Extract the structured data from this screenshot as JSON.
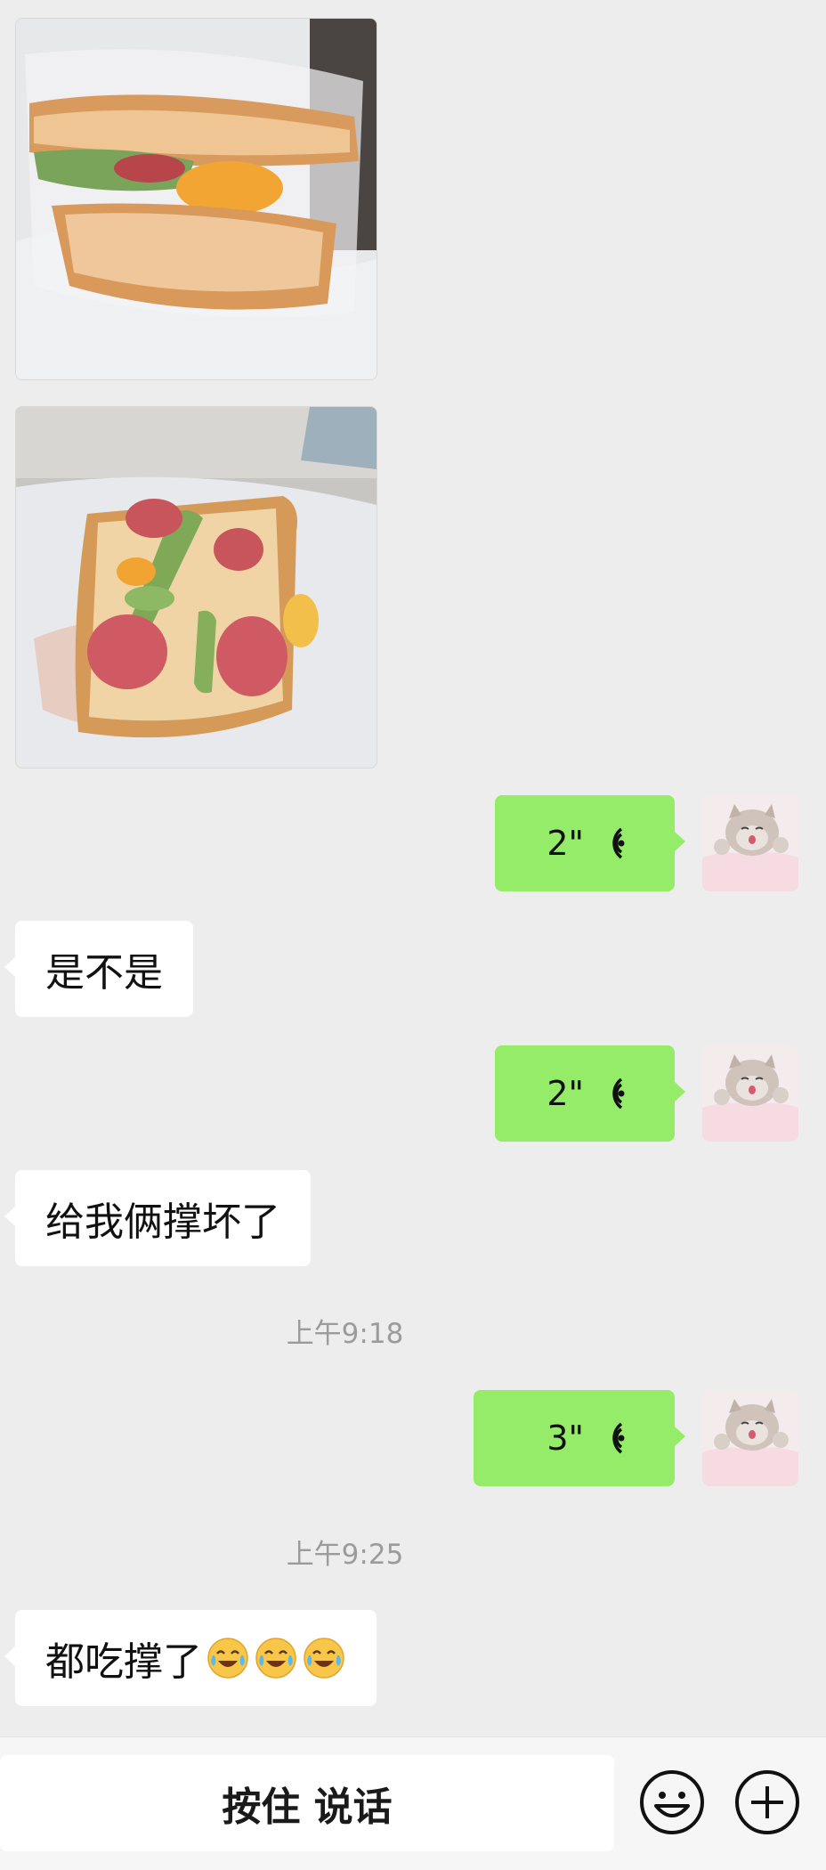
{
  "colors": {
    "background": "#ededed",
    "outgoing_bubble": "#95ec69",
    "incoming_bubble": "#ffffff",
    "timestamp_text": "#9b9b9b"
  },
  "messages": {
    "photo1": {
      "icon": "sandwich-photo"
    },
    "photo2": {
      "icon": "open-sandwich-photo"
    },
    "voice1": {
      "duration": "2\"",
      "icon": "voice-wave-icon"
    },
    "text1": {
      "text": "是不是"
    },
    "voice2": {
      "duration": "2\"",
      "icon": "voice-wave-icon"
    },
    "text2": {
      "text": "给我俩撑坏了"
    },
    "time1": {
      "text": "上午9:18"
    },
    "voice3": {
      "duration": "3\"",
      "icon": "voice-wave-icon"
    },
    "time2": {
      "text": "上午9:25"
    },
    "text3": {
      "text": "都吃撑了",
      "emojis": [
        "crying-laughing-emoji",
        "crying-laughing-emoji",
        "crying-laughing-emoji"
      ]
    }
  },
  "input_bar": {
    "hold_to_talk": "按住 说话",
    "emoji_button_icon": "smiley-icon",
    "plus_button_icon": "plus-circle-icon"
  }
}
